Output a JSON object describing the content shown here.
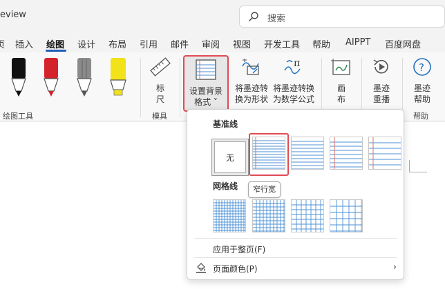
{
  "window": {
    "title_fragment": "eview"
  },
  "search": {
    "placeholder": "搜索",
    "icon": "search-icon"
  },
  "tabs": [
    {
      "label": "页"
    },
    {
      "label": "插入"
    },
    {
      "label": "绘图",
      "active": true
    },
    {
      "label": "设计"
    },
    {
      "label": "布局"
    },
    {
      "label": "引用"
    },
    {
      "label": "邮件"
    },
    {
      "label": "审阅"
    },
    {
      "label": "视图"
    },
    {
      "label": "开发工具"
    },
    {
      "label": "帮助"
    },
    {
      "label": "AIPPT"
    },
    {
      "label": "百度网盘"
    }
  ],
  "ribbon": {
    "pens": [
      {
        "name": "black-pen",
        "color": "#111111"
      },
      {
        "name": "red-pen",
        "color": "#d4232b"
      },
      {
        "name": "gray-pencil",
        "color": "#8a8a8a"
      },
      {
        "name": "yellow-highlighter",
        "color": "#f2e21a"
      }
    ],
    "group_drawing_tools": "绘图工具",
    "ruler_label_1": "标",
    "ruler_label_2": "尺",
    "group_stencils": "模具",
    "background_format_line1": "设置背景",
    "background_format_line2": "格式 ˅",
    "ink_to_shape_line1": "将墨迹转",
    "ink_to_shape_line2": "换为形状",
    "ink_to_math_line1": "将墨迹转换",
    "ink_to_math_line2": "为数学公式",
    "canvas_line1": "画",
    "canvas_line2": "布",
    "ink_replay_line1": "墨迹",
    "ink_replay_line2": "重播",
    "ink_help_line1": "墨迹",
    "ink_help_line2": "帮助",
    "group_help": "帮助"
  },
  "dropdown": {
    "section_rule_lines": "基准线",
    "none_label": "无",
    "tooltip": "窄行宽",
    "section_grid_lines": "网格线",
    "apply_to_page": "应用于整页(F)",
    "page_color": "页面颜色(P)",
    "colors": {
      "highlight": "#e04b55",
      "line_blue": "#4a8fd6",
      "margin_red": "#e06c6c"
    }
  }
}
